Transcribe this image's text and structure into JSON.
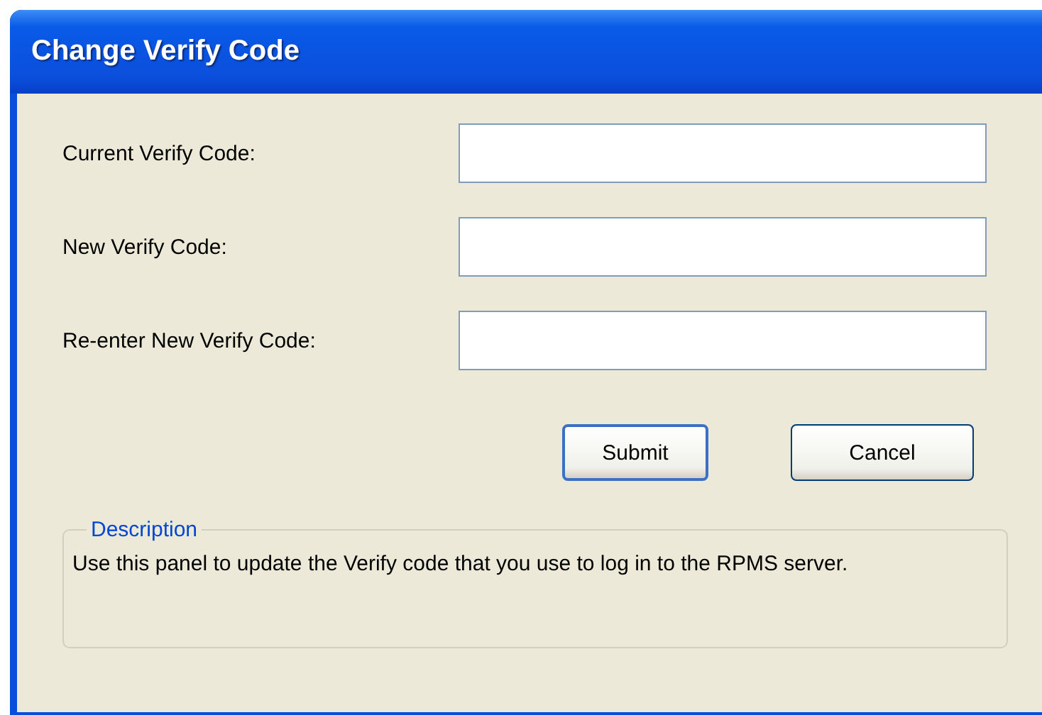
{
  "window": {
    "title": "Change Verify Code"
  },
  "fields": [
    {
      "label": "Current Verify Code:"
    },
    {
      "label": "New Verify Code:"
    },
    {
      "label": "Re-enter New Verify Code:"
    }
  ],
  "buttons": [
    {
      "label": "Submit",
      "default": true
    },
    {
      "label": "Cancel",
      "default": false
    }
  ],
  "description": {
    "legend": "Description",
    "text": "Use this panel to update the Verify code that you use to log in to the RPMS server."
  }
}
